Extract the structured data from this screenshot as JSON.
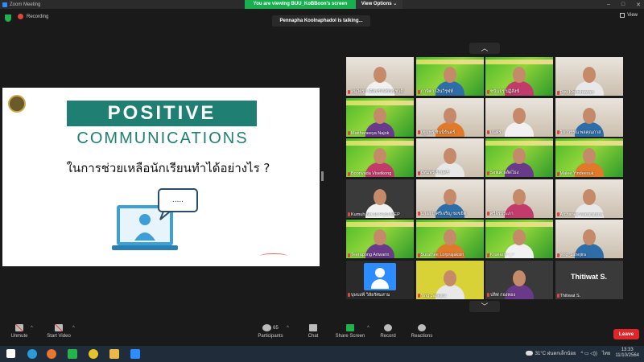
{
  "window": {
    "title": "Zoom Meeting"
  },
  "banner": {
    "viewing_text": "You are viewing BUU_KoBBoon's screen",
    "view_options": "View Options ⌄"
  },
  "meeting": {
    "recording_label": "Recording",
    "talking": "Pennapha Koolnaphadol is talking...",
    "view_label": "View"
  },
  "slide": {
    "title_line1": "POSITIVE",
    "title_line2": "COMMUNICATIONS",
    "subtitle": "ในการช่วยเหลือนักเรียนทำได้อย่างไร ?",
    "bubble_text": "....."
  },
  "gallery": {
    "up_arrow": "︿",
    "down_arrow": "﹀",
    "tiles": [
      {
        "name": "อนุวัตรา เดือนรักษ์พันธ์ชาติ",
        "style": "room"
      },
      {
        "name": "ภาษิตา เงินวิรุฬห์",
        "style": "green"
      },
      {
        "name": "ชนันธร ปฏิสังข์",
        "style": "green"
      },
      {
        "name": "Pou Khonthawan",
        "style": "room"
      },
      {
        "name": "Matthaneeya Najok",
        "style": "green"
      },
      {
        "name": "ปฐมพร ชินนิรันดร์",
        "style": "room"
      },
      {
        "name": "เณศร",
        "style": "room"
      },
      {
        "name": "วิลาวรรณ พลคุณภาส",
        "style": "room"
      },
      {
        "name": "Boonyada Visetkong",
        "style": "green"
      },
      {
        "name": "ปัทมพร รักษ์ศรี",
        "style": "room"
      },
      {
        "name": "Siriluk ผลัดไธง",
        "style": "green"
      },
      {
        "name": "Malee Yindeesuk",
        "style": "green"
      },
      {
        "name": "Kumuh No.35 P.2/3 MEP",
        "style": "dark"
      },
      {
        "name": "นางสาวศรีเจริญ ชงขยิต",
        "style": "room"
      },
      {
        "name": "ศรีจิรประภา",
        "style": "room"
      },
      {
        "name": "Atchanee Wararatana",
        "style": "room"
      },
      {
        "name": "Teerapong Artwarin",
        "style": "green"
      },
      {
        "name": "Surathee Lorprajaksiri",
        "style": "green"
      },
      {
        "name": "Kruearn ^_^",
        "style": "green"
      },
      {
        "name": "ying_Janejira",
        "style": "room"
      },
      {
        "name": "บุษบงฟ้ วิลัยรัศมสาม",
        "style": "avatar"
      },
      {
        "name": "Ying Janejira",
        "style": "yellow"
      },
      {
        "name": "ปลิฬ ก่องทอง",
        "style": "dark"
      },
      {
        "name": "Thitiwat S.",
        "style": "text",
        "big": "Thitiwat S."
      }
    ]
  },
  "toolbar": {
    "unmute": "Unmute",
    "start_video": "Start Video",
    "participants": "Participants",
    "participants_count": "65",
    "chat": "Chat",
    "share_screen": "Share Screen",
    "record": "Record",
    "reactions": "Reactions",
    "leave": "Leave",
    "caret": "^"
  },
  "taskbar": {
    "weather": "31°C ฝนตกเล็กน้อย",
    "lang": "ไทย",
    "time": "13:33",
    "date": "11/10/2564",
    "tray_icons": "^  ▭  ◁))"
  },
  "colors": {
    "accent": "#2d8cff",
    "banner_green": "#18b04e",
    "leave_red": "#e0252a",
    "slide_teal": "#1f7f72"
  }
}
